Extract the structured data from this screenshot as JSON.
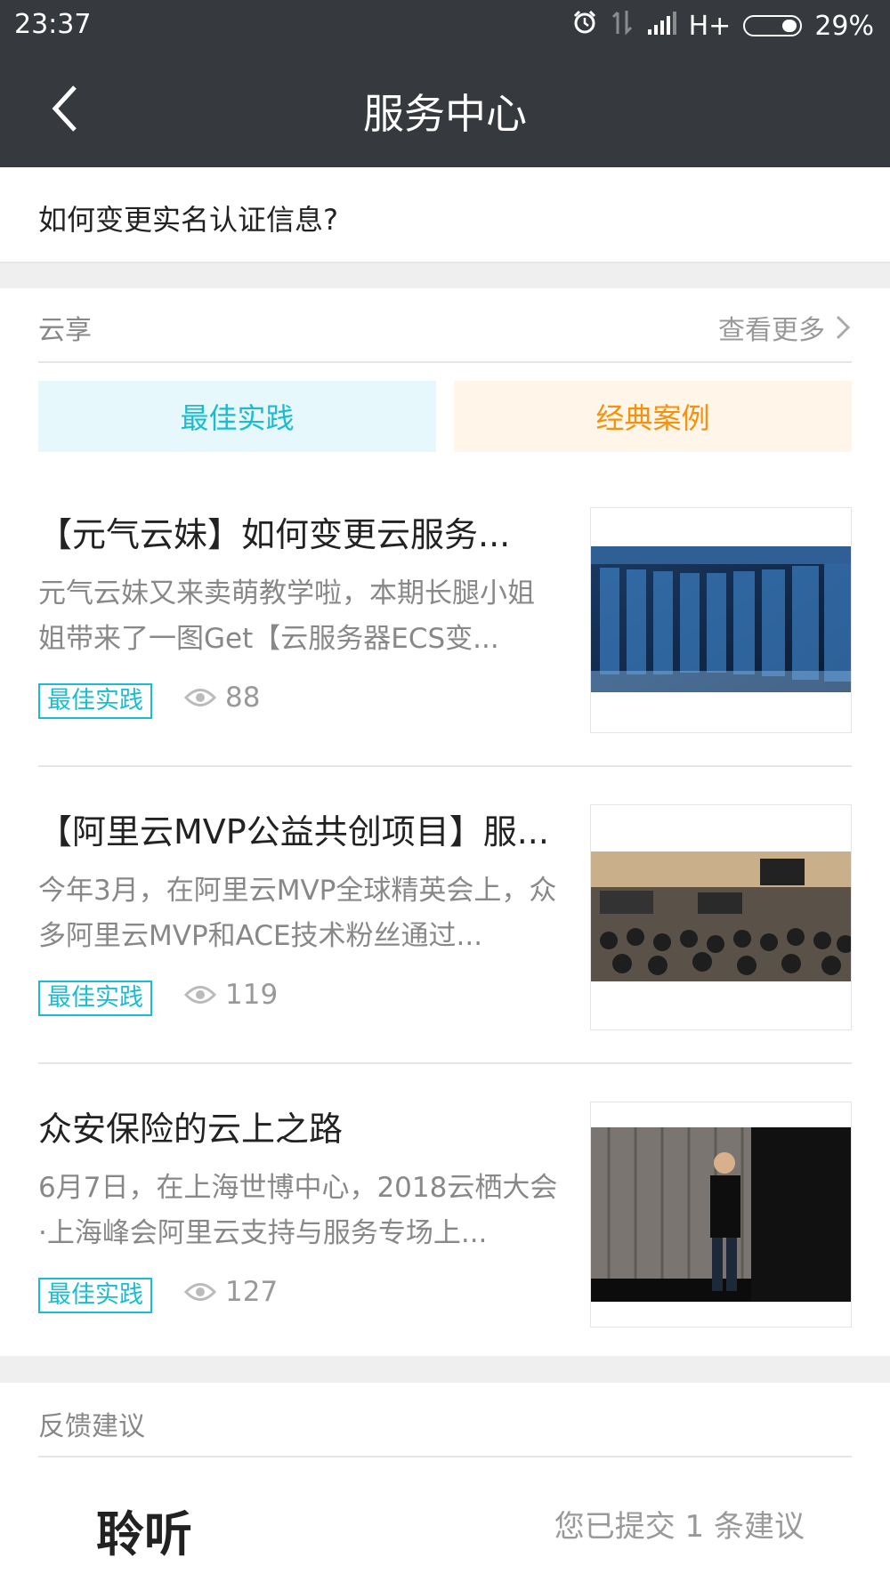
{
  "status_bar": {
    "time": "23:37",
    "network": "H+",
    "battery": "29%",
    "battery_level": 0.29
  },
  "nav": {
    "title": "服务中心"
  },
  "question": {
    "text": "如何变更实名认证信息?"
  },
  "yunxiang": {
    "label": "云享",
    "more": "查看更多",
    "tabs": [
      {
        "label": "最佳实践"
      },
      {
        "label": "经典案例"
      }
    ],
    "articles": [
      {
        "title": "【元气云妹】如何变更云服务...",
        "desc": "元气云妹又来卖萌教学啦，本期长腿小姐姐带来了一图Get【云服务器ECS变...",
        "tag": "最佳实践",
        "views": "88"
      },
      {
        "title": "【阿里云MVP公益共创项目】服...",
        "desc": "今年3月，在阿里云MVP全球精英会上，众多阿里云MVP和ACE技术粉丝通过...",
        "tag": "最佳实践",
        "views": "119"
      },
      {
        "title": "众安保险的云上之路",
        "desc": "6月7日，在上海世博中心，2018云栖大会·上海峰会阿里云支持与服务专场上...",
        "tag": "最佳实践",
        "views": "127"
      }
    ]
  },
  "feedback": {
    "label": "反馈建议",
    "listen": "聆听",
    "submitted": "您已提交 1 条建议"
  }
}
